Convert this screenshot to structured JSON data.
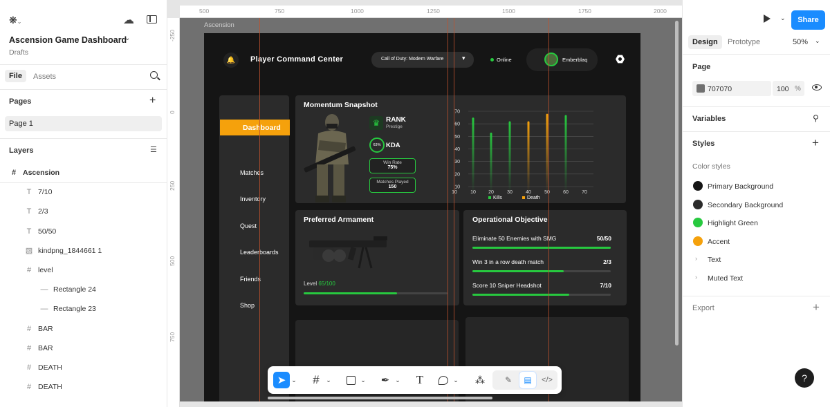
{
  "file": {
    "title": "Ascension Game Dashboard",
    "location": "Drafts"
  },
  "left_tabs": {
    "file": "File",
    "assets": "Assets"
  },
  "pages_section": {
    "title": "Pages",
    "items": [
      "Page 1"
    ]
  },
  "layers_section": {
    "title": "Layers",
    "items": [
      {
        "icon": "frame-icon",
        "name": "Ascension"
      },
      {
        "icon": "text-icon",
        "name": "7/10"
      },
      {
        "icon": "text-icon",
        "name": "2/3"
      },
      {
        "icon": "text-icon",
        "name": "50/50"
      },
      {
        "icon": "image-icon",
        "name": "kindpng_1844661 1"
      },
      {
        "icon": "frame-icon",
        "name": "level"
      },
      {
        "icon": "line-icon",
        "name": "Rectangle 24"
      },
      {
        "icon": "line-icon",
        "name": "Rectangle 23"
      },
      {
        "icon": "frame-icon",
        "name": "BAR"
      },
      {
        "icon": "frame-icon",
        "name": "BAR"
      },
      {
        "icon": "frame-icon",
        "name": "DEATH"
      },
      {
        "icon": "frame-icon",
        "name": "DEATH"
      }
    ]
  },
  "ruler": {
    "top": [
      "500",
      "750",
      "1000",
      "1250",
      "1500",
      "1750",
      "2000"
    ],
    "left": [
      "-250",
      "0",
      "250",
      "500",
      "750"
    ]
  },
  "frame_label": "Ascension",
  "dashboard": {
    "title": "Player Command Center",
    "game_select": "Call of Duty: Modern Warfare",
    "status": "Online",
    "username": "Emberblaq",
    "nav": [
      "Dashboard",
      "Matches",
      "Inventory",
      "Quest",
      "Leaderboards",
      "Friends",
      "Shop"
    ],
    "momentum": {
      "title": "Momentum Snapshot",
      "rank_label": "RANK",
      "rank_value": "Prestige",
      "kda_pct": "63%",
      "kda_label": "KDA",
      "win_rate_label": "Win Rate",
      "win_rate_value": "75%",
      "matches_label": "Matches Played",
      "matches_value": "150"
    },
    "armament": {
      "title": "Preferred Armament",
      "level_label": "Level ",
      "level_value": "65/100",
      "level_progress": 0.65
    },
    "objective": {
      "title": "Operational Objective",
      "items": [
        {
          "text": "Eliminate 50 Enemies with SMG",
          "value": "50/50",
          "progress": 1.0
        },
        {
          "text": "Win 3 in a row  death match",
          "value": "2/3",
          "progress": 0.66
        },
        {
          "text": "Score 10  Sniper Headshot",
          "value": "7/10",
          "progress": 0.7
        }
      ]
    }
  },
  "chart_data": {
    "type": "bar",
    "x_ticks": [
      "10",
      "10",
      "20",
      "30",
      "40",
      "50",
      "60",
      "70"
    ],
    "y_ticks": [
      "70",
      "60",
      "50",
      "40",
      "30",
      "20",
      "10"
    ],
    "ylim": [
      10,
      70
    ],
    "legend": [
      "Kills",
      "Death"
    ],
    "colors": {
      "Kills": "#27c93f",
      "Death": "#f5a10c"
    },
    "bars": [
      {
        "x": 10,
        "series": "Kills",
        "value": 65
      },
      {
        "x": 20,
        "series": "Kills",
        "value": 53
      },
      {
        "x": 30,
        "series": "Kills",
        "value": 62
      },
      {
        "x": 40,
        "series": "Death",
        "value": 62
      },
      {
        "x": 50,
        "series": "Death",
        "value": 68
      },
      {
        "x": 60,
        "series": "Kills",
        "value": 67
      }
    ]
  },
  "right_panel": {
    "tabs": {
      "design": "Design",
      "prototype": "Prototype"
    },
    "zoom": "50%",
    "share": "Share",
    "page_title": "Page",
    "page_color": "707070",
    "page_opacity": "100",
    "pct": "%",
    "variables": "Variables",
    "styles": "Styles",
    "color_styles_label": "Color styles",
    "color_styles": [
      {
        "name": "Primary Background",
        "color": "#151515"
      },
      {
        "name": "Secondary Background",
        "color": "#2b2b2b"
      },
      {
        "name": "Highlight Green",
        "color": "#27c93f"
      },
      {
        "name": "Accent",
        "color": "#f5a10c"
      }
    ],
    "style_groups": [
      "Text",
      "Muted Text"
    ],
    "export": "Export",
    "help": "?"
  }
}
